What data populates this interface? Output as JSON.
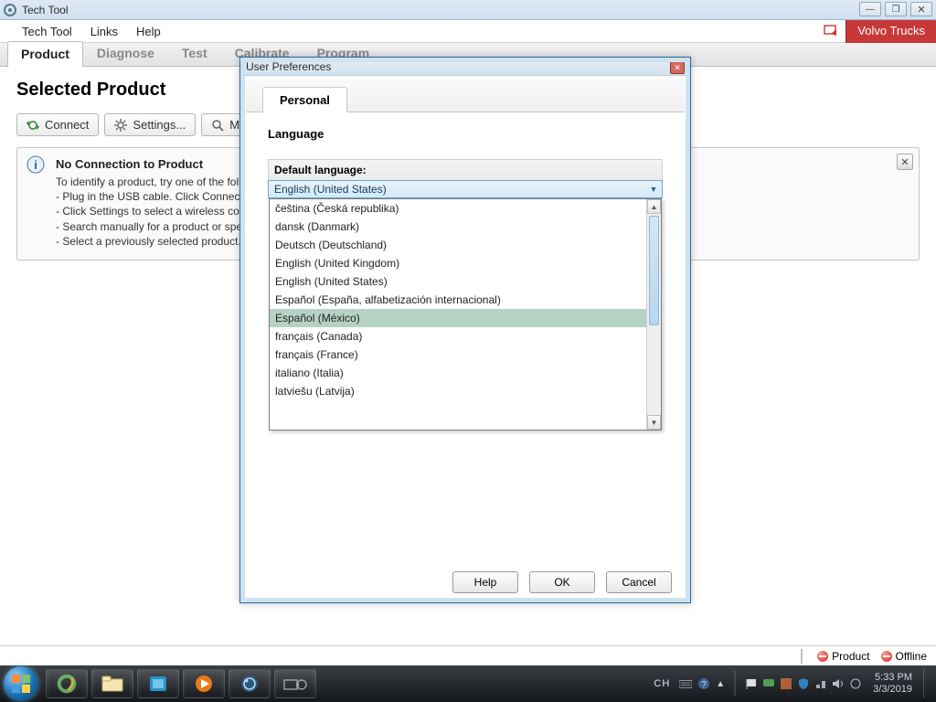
{
  "window": {
    "title": "Tech Tool"
  },
  "win_controls": {
    "min": "min",
    "max": "max",
    "close": "close"
  },
  "menubar": {
    "items": [
      "Tech Tool",
      "Links",
      "Help"
    ]
  },
  "brand": {
    "label": "Volvo Trucks"
  },
  "main_tabs": {
    "items": [
      "Product",
      "Diagnose",
      "Test",
      "Calibrate",
      "Program"
    ],
    "active_index": 0
  },
  "page": {
    "heading": "Selected Product",
    "toolbar": {
      "connect": "Connect",
      "settings": "Settings...",
      "manual": "Manual Selection..."
    },
    "info": {
      "title": "No Connection to Product",
      "body_lead": "To identify a product, try one of the following:",
      "body_lines": [
        "- Plug in the USB cable. Click Connect.",
        "- Click Settings to select a wireless connection.",
        "- Search manually for a product or specific information.",
        "- Select a previously selected product."
      ]
    }
  },
  "dialog": {
    "title": "User Preferences",
    "tab": "Personal",
    "section": "Language",
    "field_label": "Default language:",
    "selected": "English (United States)",
    "options": [
      "čeština (Česká republika)",
      "dansk (Danmark)",
      "Deutsch (Deutschland)",
      "English (United Kingdom)",
      "English (United States)",
      "Español (España, alfabetización internacional)",
      "Español (México)",
      "français (Canada)",
      "français (France)",
      "italiano (Italia)",
      "latviešu (Latvija)"
    ],
    "highlight_index": 6,
    "buttons": {
      "help": "Help",
      "ok": "OK",
      "cancel": "Cancel"
    }
  },
  "status": {
    "product": "Product",
    "offline": "Offline"
  },
  "taskbar": {
    "lang": "CH",
    "time": "5:33 PM",
    "date": "3/3/2019"
  }
}
